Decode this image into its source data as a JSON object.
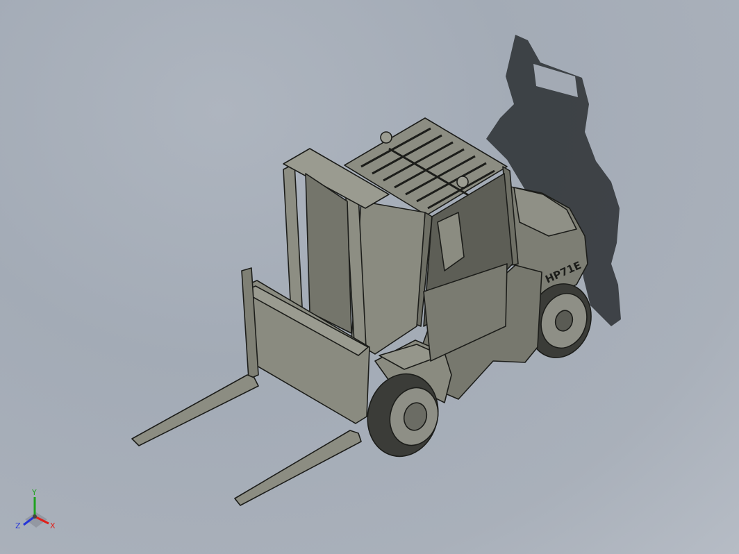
{
  "scene": {
    "model_label": "HP71E",
    "colors": {
      "background": "#a7afb9",
      "body": "#7f8075",
      "body_light": "#9a9b90",
      "body_dark": "#4e4f47",
      "outline": "#1c1d1a",
      "shadow": "#2c2f33",
      "tire": "#3b3c38",
      "rim": "#8e8f86"
    }
  },
  "triad": {
    "x_label": "X",
    "y_label": "Y",
    "z_label": "Z",
    "x_color": "#e0201a",
    "y_color": "#1fa21f",
    "z_color": "#2535d8"
  }
}
